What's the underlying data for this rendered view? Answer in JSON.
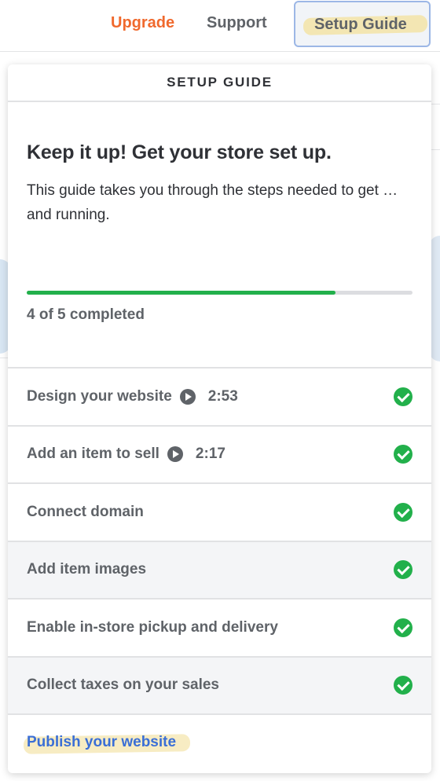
{
  "nav": {
    "upgrade_label": "Upgrade",
    "support_label": "Support",
    "setup_guide_label": "Setup Guide"
  },
  "panel": {
    "header": "SETUP GUIDE",
    "title": "Keep it up! Get your store set up.",
    "description": "This guide takes you through the steps needed to get … and running.",
    "progress": {
      "completed": 4,
      "total": 5,
      "label": "4 of 5 completed"
    },
    "steps": [
      {
        "label": "Design your website",
        "duration": "2:53",
        "has_video": true,
        "completed": true
      },
      {
        "label": "Add an item to sell",
        "duration": "2:17",
        "has_video": true,
        "completed": true
      },
      {
        "label": "Connect domain",
        "duration": "",
        "has_video": false,
        "completed": true
      },
      {
        "label": "Add item images",
        "duration": "",
        "has_video": false,
        "completed": true
      },
      {
        "label": "Enable in-store pickup and delivery",
        "duration": "",
        "has_video": false,
        "completed": true
      },
      {
        "label": "Collect taxes on your sales",
        "duration": "",
        "has_video": false,
        "completed": true
      }
    ],
    "publish_label": "Publish your website"
  },
  "colors": {
    "upgrade": "#f0692d",
    "progress_fill": "#22b04b",
    "check": "#22b04b",
    "link": "#3b6fd6"
  }
}
